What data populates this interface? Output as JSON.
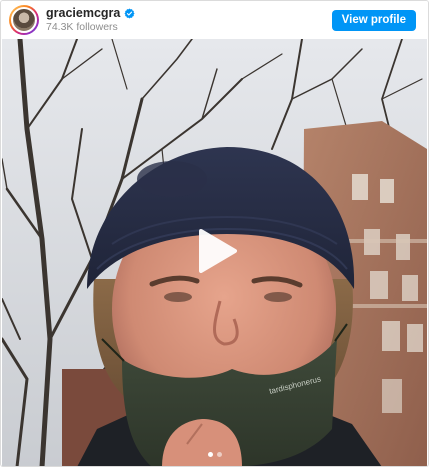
{
  "header": {
    "username": "graciemcgra",
    "verified": true,
    "followers": "74.3K followers",
    "view_profile_label": "View profile"
  },
  "media": {
    "type": "video",
    "play_icon": "play-icon",
    "mask_text": "tardisphonerus",
    "carousel": {
      "count": 2,
      "active_index": 0
    }
  },
  "colors": {
    "accent": "#0095f6",
    "username": "#262626",
    "secondary_text": "#8e8e8e"
  }
}
